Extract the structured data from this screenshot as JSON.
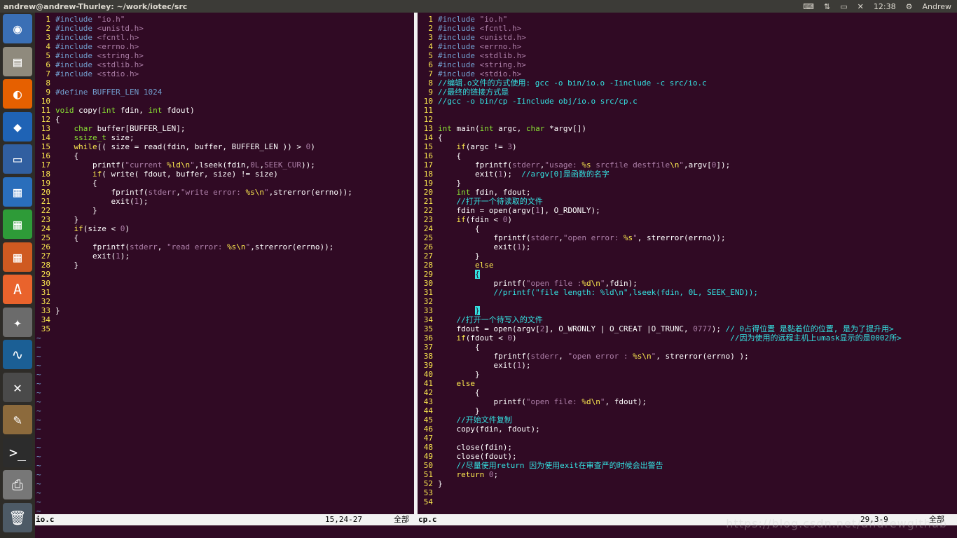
{
  "window": {
    "title": "andrew@andrew-Thurley: ~/work/iotec/src",
    "clock": "12:38",
    "user": "Andrew"
  },
  "launcher": [
    {
      "name": "ubuntu-dash",
      "icon": "◉",
      "color": "#3a6fb5"
    },
    {
      "name": "files",
      "icon": "▤",
      "color": "#8f8a7d"
    },
    {
      "name": "firefox",
      "icon": "◐",
      "color": "#e66000"
    },
    {
      "name": "vscode",
      "icon": "◆",
      "color": "#1f63b5"
    },
    {
      "name": "remote-desktop",
      "icon": "▭",
      "color": "#315fa0"
    },
    {
      "name": "writer",
      "icon": "▦",
      "color": "#2a6ebb"
    },
    {
      "name": "calc",
      "icon": "▦",
      "color": "#2e9b38"
    },
    {
      "name": "impress",
      "icon": "▦",
      "color": "#cf5a21"
    },
    {
      "name": "software-center",
      "icon": "A",
      "color": "#e9632c"
    },
    {
      "name": "system-settings",
      "icon": "✦",
      "color": "#6b6b6b"
    },
    {
      "name": "wireshark",
      "icon": "∿",
      "color": "#1b5f95"
    },
    {
      "name": "network",
      "icon": "✕",
      "color": "#4a4a4a"
    },
    {
      "name": "paint",
      "icon": "✎",
      "color": "#8c6a3c"
    },
    {
      "name": "terminal",
      "icon": ">_",
      "color": "#2c2c2c"
    },
    {
      "name": "printer",
      "icon": "⎙",
      "color": "#777"
    },
    {
      "name": "trash",
      "icon": "🗑",
      "color": "#4d5a66"
    }
  ],
  "left": {
    "filename": "io.c",
    "position": "15,24-27",
    "percent": "全部",
    "lines": [
      [
        [
          "pp",
          "#include "
        ],
        [
          "str",
          "\"io.h\""
        ]
      ],
      [
        [
          "pp",
          "#include "
        ],
        [
          "str",
          "<unistd.h>"
        ]
      ],
      [
        [
          "pp",
          "#include "
        ],
        [
          "str",
          "<fcntl.h>"
        ]
      ],
      [
        [
          "pp",
          "#include "
        ],
        [
          "str",
          "<errno.h>"
        ]
      ],
      [
        [
          "pp",
          "#include "
        ],
        [
          "str",
          "<string.h>"
        ]
      ],
      [
        [
          "pp",
          "#include "
        ],
        [
          "str",
          "<stdlib.h>"
        ]
      ],
      [
        [
          "pp",
          "#include "
        ],
        [
          "str",
          "<stdio.h>"
        ]
      ],
      [],
      [
        [
          "pp",
          "#define BUFFER_LEN 1024"
        ]
      ],
      [],
      [
        [
          "type",
          "void"
        ],
        [
          "n",
          " copy("
        ],
        [
          "type",
          "int"
        ],
        [
          "n",
          " fdin, "
        ],
        [
          "type",
          "int"
        ],
        [
          "n",
          " fdout)"
        ]
      ],
      [
        [
          "n",
          "{"
        ]
      ],
      [
        [
          "n",
          "    "
        ],
        [
          "type",
          "char"
        ],
        [
          "n",
          " buffer[BUFFER_LEN];"
        ]
      ],
      [
        [
          "n",
          "    "
        ],
        [
          "type",
          "ssize_t"
        ],
        [
          "n",
          " size;"
        ]
      ],
      [
        [
          "n",
          "    "
        ],
        [
          "kw",
          "while"
        ],
        [
          "n",
          "(( size = read(fdin, buffer, BUFFER_LEN )) > "
        ],
        [
          "str",
          "0"
        ],
        [
          "n",
          ")"
        ]
      ],
      [
        [
          "n",
          "    {"
        ]
      ],
      [
        [
          "n",
          "        printf("
        ],
        [
          "str",
          "\"current "
        ],
        [
          "kw",
          "%ld\\n"
        ],
        [
          "str",
          "\""
        ],
        [
          "n",
          ",lseek(fdin,"
        ],
        [
          "str",
          "0L"
        ],
        [
          "n",
          ","
        ],
        [
          "str",
          "SEEK_CUR"
        ],
        [
          "n",
          "));"
        ]
      ],
      [
        [
          "n",
          "        "
        ],
        [
          "kw",
          "if"
        ],
        [
          "n",
          "( write( fdout, buffer, size) != size)"
        ]
      ],
      [
        [
          "n",
          "        {"
        ]
      ],
      [
        [
          "n",
          "            fprintf("
        ],
        [
          "str",
          "stderr"
        ],
        [
          "n",
          ","
        ],
        [
          "str",
          "\"write error: "
        ],
        [
          "kw",
          "%s\\n"
        ],
        [
          "str",
          "\""
        ],
        [
          "n",
          ",strerror(errno));"
        ]
      ],
      [
        [
          "n",
          "            exit("
        ],
        [
          "str",
          "1"
        ],
        [
          "n",
          ");"
        ]
      ],
      [
        [
          "n",
          "        }"
        ]
      ],
      [
        [
          "n",
          "    }"
        ]
      ],
      [
        [
          "n",
          "    "
        ],
        [
          "kw",
          "if"
        ],
        [
          "n",
          "(size < "
        ],
        [
          "str",
          "0"
        ],
        [
          "n",
          ")"
        ]
      ],
      [
        [
          "n",
          "    {"
        ]
      ],
      [
        [
          "n",
          "        fprintf("
        ],
        [
          "str",
          "stderr"
        ],
        [
          "n",
          ", "
        ],
        [
          "str",
          "\"read error: "
        ],
        [
          "kw",
          "%s\\n"
        ],
        [
          "str",
          "\""
        ],
        [
          "n",
          ",strerror(errno));"
        ]
      ],
      [
        [
          "n",
          "        exit("
        ],
        [
          "str",
          "1"
        ],
        [
          "n",
          ");"
        ]
      ],
      [
        [
          "n",
          "    }"
        ]
      ],
      [],
      [],
      [],
      [],
      [
        [
          "n",
          "}"
        ]
      ],
      [],
      []
    ],
    "tildes": 20
  },
  "right": {
    "filename": "cp.c",
    "position": "29,3-9",
    "percent": "全部",
    "lines": [
      [
        [
          "pp",
          "#include "
        ],
        [
          "str",
          "\"io.h\""
        ]
      ],
      [
        [
          "pp",
          "#include "
        ],
        [
          "str",
          "<fcntl.h>"
        ]
      ],
      [
        [
          "pp",
          "#include "
        ],
        [
          "str",
          "<unistd.h>"
        ]
      ],
      [
        [
          "pp",
          "#include "
        ],
        [
          "str",
          "<errno.h>"
        ]
      ],
      [
        [
          "pp",
          "#include "
        ],
        [
          "str",
          "<stdlib.h>"
        ]
      ],
      [
        [
          "pp",
          "#include "
        ],
        [
          "str",
          "<string.h>"
        ]
      ],
      [
        [
          "pp",
          "#include "
        ],
        [
          "str",
          "<stdio.h>"
        ]
      ],
      [
        [
          "com",
          "//编辑.o文件的方式使用: gcc -o bin/io.o -Iinclude -c src/io.c"
        ]
      ],
      [
        [
          "com",
          "//最终的链接方式是"
        ]
      ],
      [
        [
          "com",
          "//gcc -o bin/cp -Iinclude obj/io.o src/cp.c"
        ]
      ],
      [],
      [],
      [
        [
          "type",
          "int"
        ],
        [
          "n",
          " main("
        ],
        [
          "type",
          "int"
        ],
        [
          "n",
          " argc, "
        ],
        [
          "type",
          "char"
        ],
        [
          "n",
          " *argv[])"
        ]
      ],
      [
        [
          "n",
          "{"
        ]
      ],
      [
        [
          "n",
          "    "
        ],
        [
          "kw",
          "if"
        ],
        [
          "n",
          "(argc != "
        ],
        [
          "str",
          "3"
        ],
        [
          "n",
          ")"
        ]
      ],
      [
        [
          "n",
          "    {"
        ]
      ],
      [
        [
          "n",
          "        fprintf("
        ],
        [
          "str",
          "stderr"
        ],
        [
          "n",
          ","
        ],
        [
          "str",
          "\"usage: "
        ],
        [
          "kw",
          "%s"
        ],
        [
          "str",
          " srcfile destfile"
        ],
        [
          "kw",
          "\\n"
        ],
        [
          "str",
          "\""
        ],
        [
          "n",
          ",argv["
        ],
        [
          "str",
          "0"
        ],
        [
          "n",
          "]);"
        ]
      ],
      [
        [
          "n",
          "        exit("
        ],
        [
          "str",
          "1"
        ],
        [
          "n",
          ");  "
        ],
        [
          "com",
          "//argv[0]是函数的名字"
        ]
      ],
      [
        [
          "n",
          "    }"
        ]
      ],
      [
        [
          "n",
          "    "
        ],
        [
          "type",
          "int"
        ],
        [
          "n",
          " fdin, fdout;"
        ]
      ],
      [
        [
          "n",
          "    "
        ],
        [
          "com",
          "//打开一个待读取的文件"
        ]
      ],
      [
        [
          "n",
          "    fdin = open(argv["
        ],
        [
          "str",
          "1"
        ],
        [
          "n",
          "], O_RDONLY);"
        ]
      ],
      [
        [
          "n",
          "    "
        ],
        [
          "kw",
          "if"
        ],
        [
          "n",
          "(fdin < "
        ],
        [
          "str",
          "0"
        ],
        [
          "n",
          ")"
        ]
      ],
      [
        [
          "n",
          "        {"
        ]
      ],
      [
        [
          "n",
          "            fprintf("
        ],
        [
          "str",
          "stderr"
        ],
        [
          "n",
          ","
        ],
        [
          "str",
          "\"open error: "
        ],
        [
          "kw",
          "%s"
        ],
        [
          "str",
          "\""
        ],
        [
          "n",
          ", strerror(errno));"
        ]
      ],
      [
        [
          "n",
          "            exit("
        ],
        [
          "str",
          "1"
        ],
        [
          "n",
          ");"
        ]
      ],
      [
        [
          "n",
          "        }"
        ]
      ],
      [
        [
          "n",
          "        "
        ],
        [
          "kw",
          "else"
        ]
      ],
      [
        [
          "n",
          "        "
        ],
        [
          "cur",
          "{"
        ]
      ],
      [
        [
          "n",
          "            printf("
        ],
        [
          "str",
          "\"open file :"
        ],
        [
          "kw",
          "%d\\n"
        ],
        [
          "str",
          "\""
        ],
        [
          "n",
          ",fdin);"
        ]
      ],
      [
        [
          "n",
          "            "
        ],
        [
          "com",
          "//printf(\"file length: %ld\\n\",lseek(fdin, 0L, SEEK_END));"
        ]
      ],
      [],
      [
        [
          "n",
          "        "
        ],
        [
          "cur",
          "}"
        ]
      ],
      [
        [
          "n",
          "    "
        ],
        [
          "com",
          "//打开一个待写入的文件"
        ]
      ],
      [
        [
          "n",
          "    fdout = open(argv["
        ],
        [
          "str",
          "2"
        ],
        [
          "n",
          "], O_WRONLY | O_CREAT |O_TRUNC, "
        ],
        [
          "str",
          "0777"
        ],
        [
          "n",
          ");"
        ],
        [
          "com",
          " // 0占得位置 是黏着位的位置, 是为了提升用>"
        ]
      ],
      [
        [
          "n",
          "    "
        ],
        [
          "kw",
          "if"
        ],
        [
          "n",
          "(fdout < "
        ],
        [
          "str",
          "0"
        ],
        [
          "n",
          ")"
        ],
        [
          "com",
          "                                              //因为使用的远程主机上umask显示的是0002所>"
        ]
      ],
      [
        [
          "n",
          "        {"
        ]
      ],
      [
        [
          "n",
          "            fprintf("
        ],
        [
          "str",
          "stderr"
        ],
        [
          "n",
          ", "
        ],
        [
          "str",
          "\"open error : "
        ],
        [
          "kw",
          "%s\\n"
        ],
        [
          "str",
          "\""
        ],
        [
          "n",
          ", strerror(errno) );"
        ]
      ],
      [
        [
          "n",
          "            exit("
        ],
        [
          "str",
          "1"
        ],
        [
          "n",
          ");"
        ]
      ],
      [
        [
          "n",
          "        }"
        ]
      ],
      [
        [
          "n",
          "    "
        ],
        [
          "kw",
          "else"
        ]
      ],
      [
        [
          "n",
          "        {"
        ]
      ],
      [
        [
          "n",
          "            printf("
        ],
        [
          "str",
          "\"open file: "
        ],
        [
          "kw",
          "%d\\n"
        ],
        [
          "str",
          "\""
        ],
        [
          "n",
          ", fdout);"
        ]
      ],
      [
        [
          "n",
          "        }"
        ]
      ],
      [
        [
          "n",
          "    "
        ],
        [
          "com",
          "//开始文件复制"
        ]
      ],
      [
        [
          "n",
          "    copy(fdin, fdout);"
        ]
      ],
      [],
      [
        [
          "n",
          "    close(fdin);"
        ]
      ],
      [
        [
          "n",
          "    close(fdout);"
        ]
      ],
      [
        [
          "n",
          "    "
        ],
        [
          "com",
          "//尽量使用return 因为使用exit在审查严的时候会出警告"
        ]
      ],
      [
        [
          "n",
          "    "
        ],
        [
          "kw",
          "return"
        ],
        [
          "n",
          " "
        ],
        [
          "str",
          "0"
        ],
        [
          "n",
          ";"
        ]
      ],
      [
        [
          "n",
          "}"
        ]
      ],
      [],
      []
    ]
  },
  "watermark": "https://blog.csdn.net/andrewgithub"
}
